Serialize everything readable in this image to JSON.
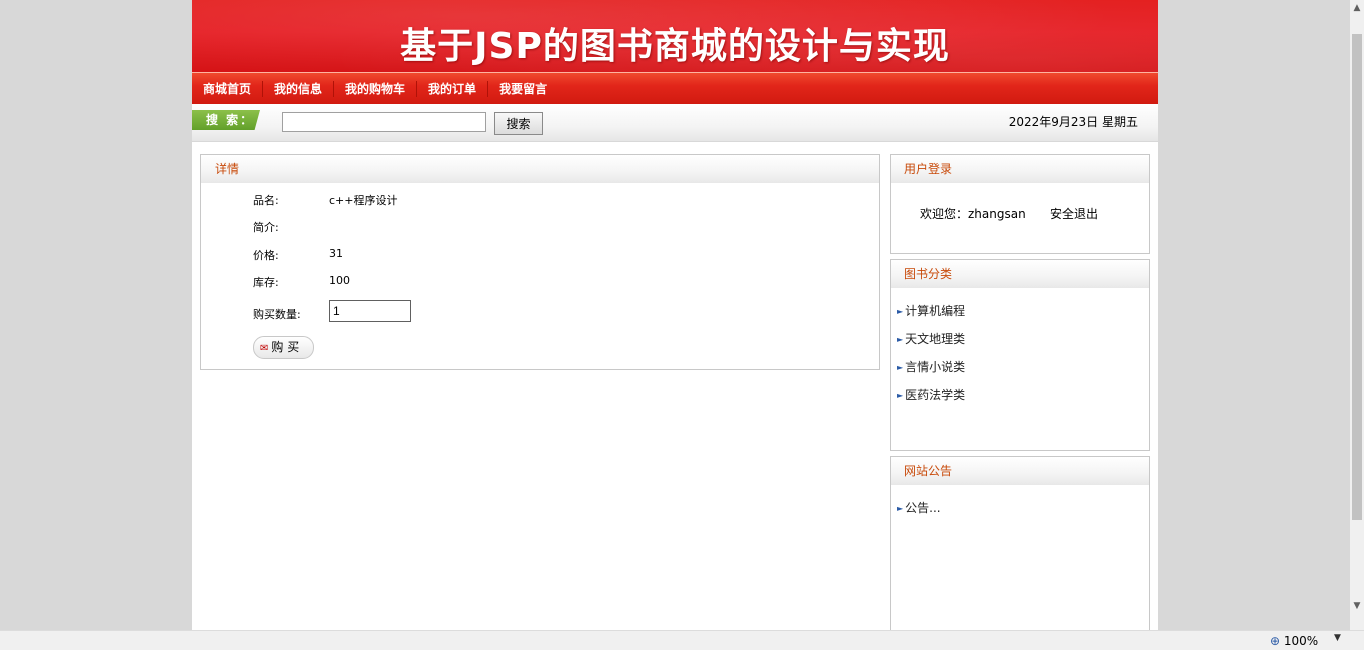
{
  "banner": {
    "title": "基于JSP的图书商城的设计与实现"
  },
  "nav": {
    "items": [
      "商城首页",
      "我的信息",
      "我的购物车",
      "我的订单",
      "我要留言"
    ]
  },
  "search": {
    "label": "搜 索：",
    "value": "",
    "button": "搜索"
  },
  "date": "2022年9月23日 星期五",
  "detail": {
    "header": "详情",
    "fields": [
      {
        "label": "品名:",
        "value": "c++程序设计"
      },
      {
        "label": "简介:",
        "value": ""
      },
      {
        "label": "价格:",
        "value": "31"
      },
      {
        "label": "库存:",
        "value": "100"
      }
    ],
    "qty_label": "购买数量:",
    "qty_value": "1",
    "buy_label": "购 买"
  },
  "login": {
    "header": "用户登录",
    "welcome": "欢迎您：zhangsan",
    "logout": "安全退出"
  },
  "categories": {
    "header": "图书分类",
    "items": [
      "计算机编程",
      "天文地理类",
      "言情小说类",
      "医药法学类"
    ]
  },
  "notice": {
    "header": "网站公告",
    "items": [
      "公告..."
    ]
  },
  "statusbar": {
    "zoom": "100%"
  },
  "colors": {
    "banner": "#e31c1c",
    "nav": "#d11a10",
    "search_label": "#62a02a",
    "panel_title": "#c84a0a"
  }
}
